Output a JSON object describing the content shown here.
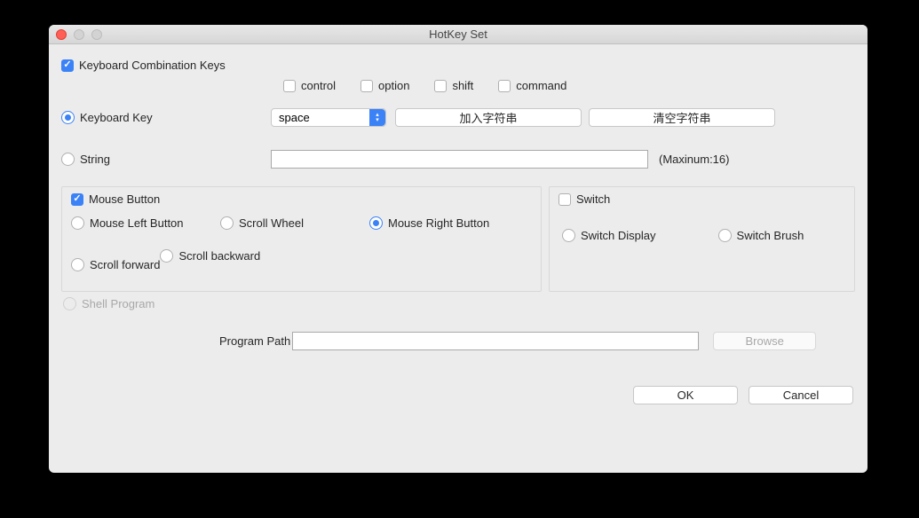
{
  "window": {
    "title": "HotKey Set"
  },
  "sections": {
    "combo": {
      "label": "Keyboard Combination Keys",
      "checked": true,
      "modifiers": {
        "control": {
          "label": "control",
          "checked": false
        },
        "option": {
          "label": "option",
          "checked": false
        },
        "shift": {
          "label": "shift",
          "checked": false
        },
        "command": {
          "label": "command",
          "checked": false
        }
      }
    },
    "key": {
      "label": "Keyboard Key",
      "selected": true,
      "select_value": "space",
      "btn_add": "加入字符串",
      "btn_clear": "清空字符串"
    },
    "string": {
      "label": "String",
      "selected": false,
      "value": "",
      "hint": "(Maxinum:16)"
    },
    "mouse": {
      "label": "Mouse Button",
      "checked": true,
      "options": {
        "left": {
          "label": "Mouse Left Button",
          "selected": false
        },
        "wheel": {
          "label": "Scroll Wheel",
          "selected": false
        },
        "right": {
          "label": "Mouse Right Button",
          "selected": true
        },
        "fwd": {
          "label": "Scroll forward",
          "selected": false
        },
        "bwd": {
          "label": "Scroll backward",
          "selected": false
        }
      }
    },
    "switch": {
      "label": "Switch",
      "checked": false,
      "options": {
        "display": {
          "label": "Switch Display",
          "selected": false
        },
        "brush": {
          "label": "Switch Brush",
          "selected": false
        }
      }
    },
    "shell": {
      "label": "Shell Program",
      "enabled": false,
      "path_label": "Program Path",
      "path_value": "",
      "browse": "Browse"
    }
  },
  "footer": {
    "ok": "OK",
    "cancel": "Cancel"
  }
}
